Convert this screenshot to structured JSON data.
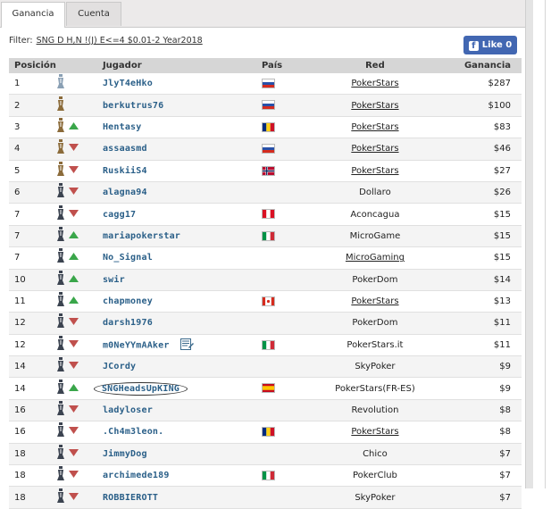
{
  "tabs": [
    {
      "label": "Ganancia",
      "active": true
    },
    {
      "label": "Cuenta",
      "active": false
    }
  ],
  "filter": {
    "label": "Filter:",
    "value": "SNG D H,N !(J) E<=4 $0.01-2 Year2018"
  },
  "like_button": {
    "label": "Like 0"
  },
  "table": {
    "headers": [
      "Posición",
      "Jugador",
      "País",
      "Red",
      "Ganancia"
    ],
    "rows": [
      {
        "pos": "1",
        "player": "JlyT4eHko",
        "flag": "ru",
        "network": "PokerStars",
        "net_link": true,
        "gain": "$287",
        "trend": "none",
        "rank_icon": "silver"
      },
      {
        "pos": "2",
        "player": "berkutrus76",
        "flag": "ru",
        "network": "PokerStars",
        "net_link": true,
        "gain": "$100",
        "trend": "none",
        "rank_icon": "bronze"
      },
      {
        "pos": "3",
        "player": "Hentasy",
        "flag": "ro",
        "network": "PokerStars",
        "net_link": true,
        "gain": "$83",
        "trend": "up",
        "rank_icon": "bronze"
      },
      {
        "pos": "4",
        "player": "assaasmd",
        "flag": "ru",
        "network": "PokerStars",
        "net_link": true,
        "gain": "$46",
        "trend": "down",
        "rank_icon": "bronze"
      },
      {
        "pos": "5",
        "player": "RuskiiS4",
        "flag": "no",
        "network": "PokerStars",
        "net_link": true,
        "gain": "$27",
        "trend": "down",
        "rank_icon": "bronze"
      },
      {
        "pos": "6",
        "player": "alagna94",
        "flag": "",
        "network": "Dollaro",
        "net_link": false,
        "gain": "$26",
        "trend": "down",
        "rank_icon": "dark"
      },
      {
        "pos": "7",
        "player": "cagg17",
        "flag": "pe",
        "network": "Aconcagua",
        "net_link": false,
        "gain": "$15",
        "trend": "down",
        "rank_icon": "dark"
      },
      {
        "pos": "7",
        "player": "mariapokerstar",
        "flag": "it",
        "network": "MicroGame",
        "net_link": false,
        "gain": "$15",
        "trend": "up",
        "rank_icon": "dark"
      },
      {
        "pos": "7",
        "player": "No_Signal",
        "flag": "",
        "network": "MicroGaming",
        "net_link": true,
        "gain": "$15",
        "trend": "up",
        "rank_icon": "dark"
      },
      {
        "pos": "10",
        "player": "swir",
        "flag": "",
        "network": "PokerDom",
        "net_link": false,
        "gain": "$14",
        "trend": "up",
        "rank_icon": "dark"
      },
      {
        "pos": "11",
        "player": "chapmoney",
        "flag": "ca",
        "network": "PokerStars",
        "net_link": true,
        "gain": "$13",
        "trend": "up",
        "rank_icon": "dark"
      },
      {
        "pos": "12",
        "player": "darsh1976",
        "flag": "",
        "network": "PokerDom",
        "net_link": false,
        "gain": "$11",
        "trend": "down",
        "rank_icon": "dark"
      },
      {
        "pos": "12",
        "player": "m0NeYYmAAker",
        "flag": "it",
        "network": "PokerStars.it",
        "net_link": false,
        "gain": "$11",
        "trend": "down",
        "rank_icon": "dark",
        "notes": true
      },
      {
        "pos": "14",
        "player": "JCordy",
        "flag": "",
        "network": "SkyPoker",
        "net_link": false,
        "gain": "$9",
        "trend": "down",
        "rank_icon": "dark"
      },
      {
        "pos": "14",
        "player": "SNGHeadsUpKING",
        "flag": "es",
        "network": "PokerStars(FR-ES)",
        "net_link": false,
        "gain": "$9",
        "trend": "up",
        "rank_icon": "dark",
        "circled": true
      },
      {
        "pos": "16",
        "player": "ladyloser",
        "flag": "",
        "network": "Revolution",
        "net_link": false,
        "gain": "$8",
        "trend": "down",
        "rank_icon": "dark"
      },
      {
        "pos": "16",
        "player": ".Ch4m3leon.",
        "flag": "ro",
        "network": "PokerStars",
        "net_link": true,
        "gain": "$8",
        "trend": "down",
        "rank_icon": "dark"
      },
      {
        "pos": "18",
        "player": "JimmyDog",
        "flag": "",
        "network": "Chico",
        "net_link": false,
        "gain": "$7",
        "trend": "down",
        "rank_icon": "dark"
      },
      {
        "pos": "18",
        "player": "archimede189",
        "flag": "it",
        "network": "PokerClub",
        "net_link": false,
        "gain": "$7",
        "trend": "down",
        "rank_icon": "dark"
      },
      {
        "pos": "18",
        "player": "ROBBIEROTT",
        "flag": "",
        "network": "SkyPoker",
        "net_link": false,
        "gain": "$7",
        "trend": "down",
        "rank_icon": "dark"
      }
    ]
  },
  "colors": {
    "up": "#3aa64a",
    "down": "#c0504d",
    "link": "#2a5f88",
    "like": "#4267b2"
  }
}
